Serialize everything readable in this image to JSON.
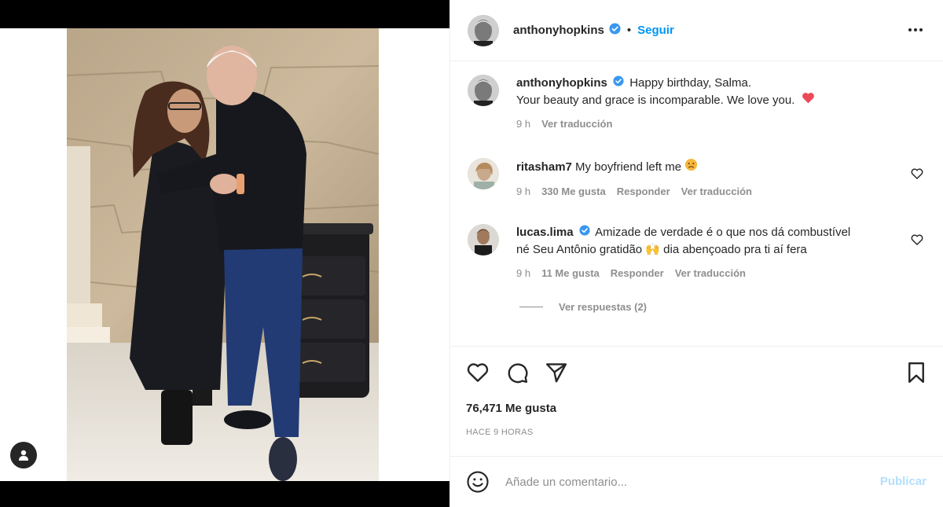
{
  "post": {
    "author": "anthonyhopkins",
    "follow_label": "Seguir",
    "dot": "•",
    "caption_line1": "Happy birthday, Salma.",
    "caption_line2": "Your beauty and grace is incomparable. We love you.",
    "caption_time": "9 h",
    "translate_label": "Ver traducción"
  },
  "comments": [
    {
      "user": "ritasham7",
      "text": "My boyfriend left me",
      "time": "9 h",
      "likes": "330 Me gusta",
      "reply_label": "Responder",
      "translate_label": "Ver traducción"
    },
    {
      "user": "lucas.lima",
      "text_line1": "Amizade de verdade é o que nos dá combustível",
      "text_line2": "né Seu Antônio gratidão 🙌 dia abençoado pra ti aí fera",
      "time": "9 h",
      "likes": "11 Me gusta",
      "reply_label": "Responder",
      "translate_label": "Ver traducción",
      "view_replies": "Ver respuestas (2)"
    }
  ],
  "stats": {
    "likes": "76,471 Me gusta",
    "posted_ago": "HACE 9 HORAS"
  },
  "composer": {
    "placeholder": "Añade un comentario...",
    "publish_label": "Publicar"
  },
  "colors": {
    "accent": "#0095f6",
    "publish_disabled": "#b2dffc",
    "heart_red": "#ed4956"
  },
  "icons": [
    "more-options-icon",
    "verified-badge-icon",
    "heart-icon",
    "comment-icon",
    "share-icon",
    "bookmark-icon",
    "emoji-icon",
    "user-tag-icon"
  ]
}
